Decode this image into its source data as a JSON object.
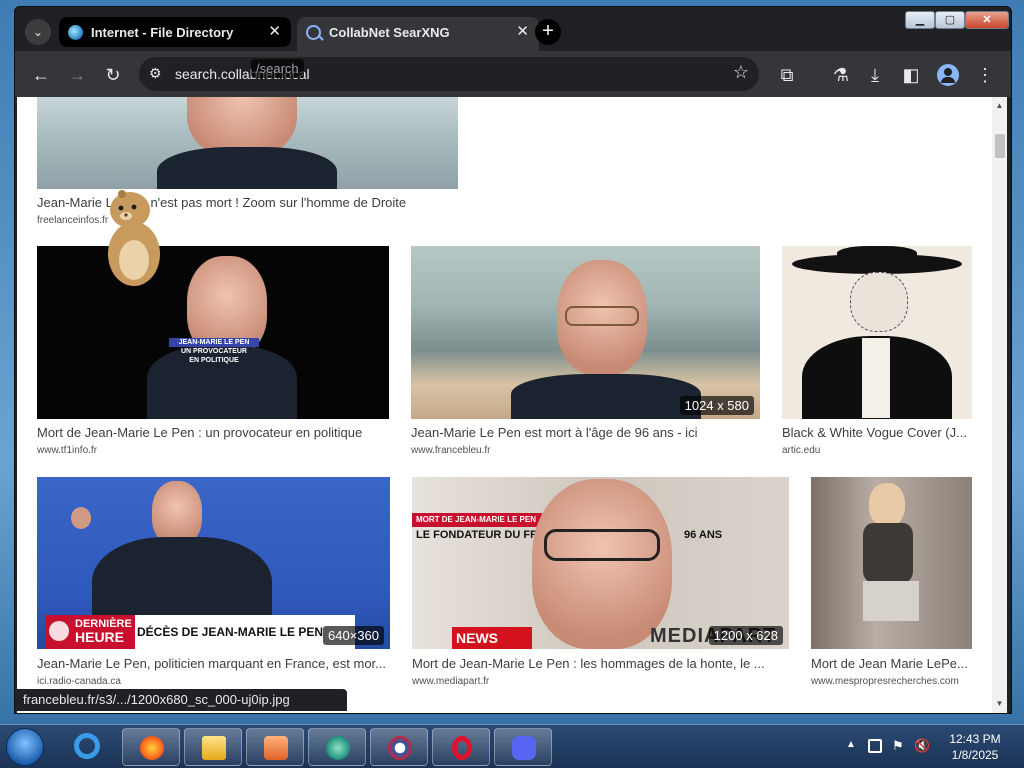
{
  "browser": {
    "tabs": [
      {
        "title": "Internet - File Directory",
        "active": false
      },
      {
        "title": "CollabNet SearXNG",
        "active": true
      }
    ],
    "address": {
      "domain": "search.collabnet.local",
      "path": "/search"
    },
    "status_url": "francebleu.fr/s3/.../1200x680_sc_000-uj0ip.jpg"
  },
  "results": [
    {
      "caption": "Jean-Marie Le Pen n'est pas mort ! Zoom sur l'homme de Droite",
      "source": "freelanceinfos.fr",
      "dims": ""
    },
    {
      "caption": "Mort de Jean-Marie Le Pen : un provocateur en politique",
      "source": "www.tf1info.fr",
      "dims": "",
      "overlay": [
        "JEAN-MARIE LE PEN",
        "UN PROVOCATEUR",
        "EN POLITIQUE"
      ]
    },
    {
      "caption": "Jean-Marie Le Pen est mort à l'âge de 96 ans - ici",
      "source": "www.francebleu.fr",
      "dims": "1024 x 580"
    },
    {
      "caption": "Black & White Vogue Cover (J...",
      "source": "artic.edu",
      "dims": ""
    },
    {
      "caption": "Jean-Marie Le Pen, politicien marquant en France, est mor...",
      "source": "ici.radio-canada.ca",
      "dims": "640×360",
      "overlay": [
        "DERNIÈRE",
        "HEURE",
        "DÉCÈS DE JEAN-MARIE LE PEN"
      ]
    },
    {
      "caption": "Mort de Jean-Marie Le Pen : les hommages de la honte, le ...",
      "source": "www.mediapart.fr",
      "dims": "1200 x 628",
      "overlay": [
        "MORT DE JEAN-MARIE LE PEN",
        "LE FONDATEUR DU FR",
        "96 ANS",
        "NEWS",
        "MEDIAPART"
      ]
    },
    {
      "caption": "Mort de Jean Marie LePe...",
      "source": "www.mespropresrecherches.com",
      "dims": ""
    }
  ],
  "taskbar": {
    "time": "12:43 PM",
    "date": "1/8/2025"
  }
}
